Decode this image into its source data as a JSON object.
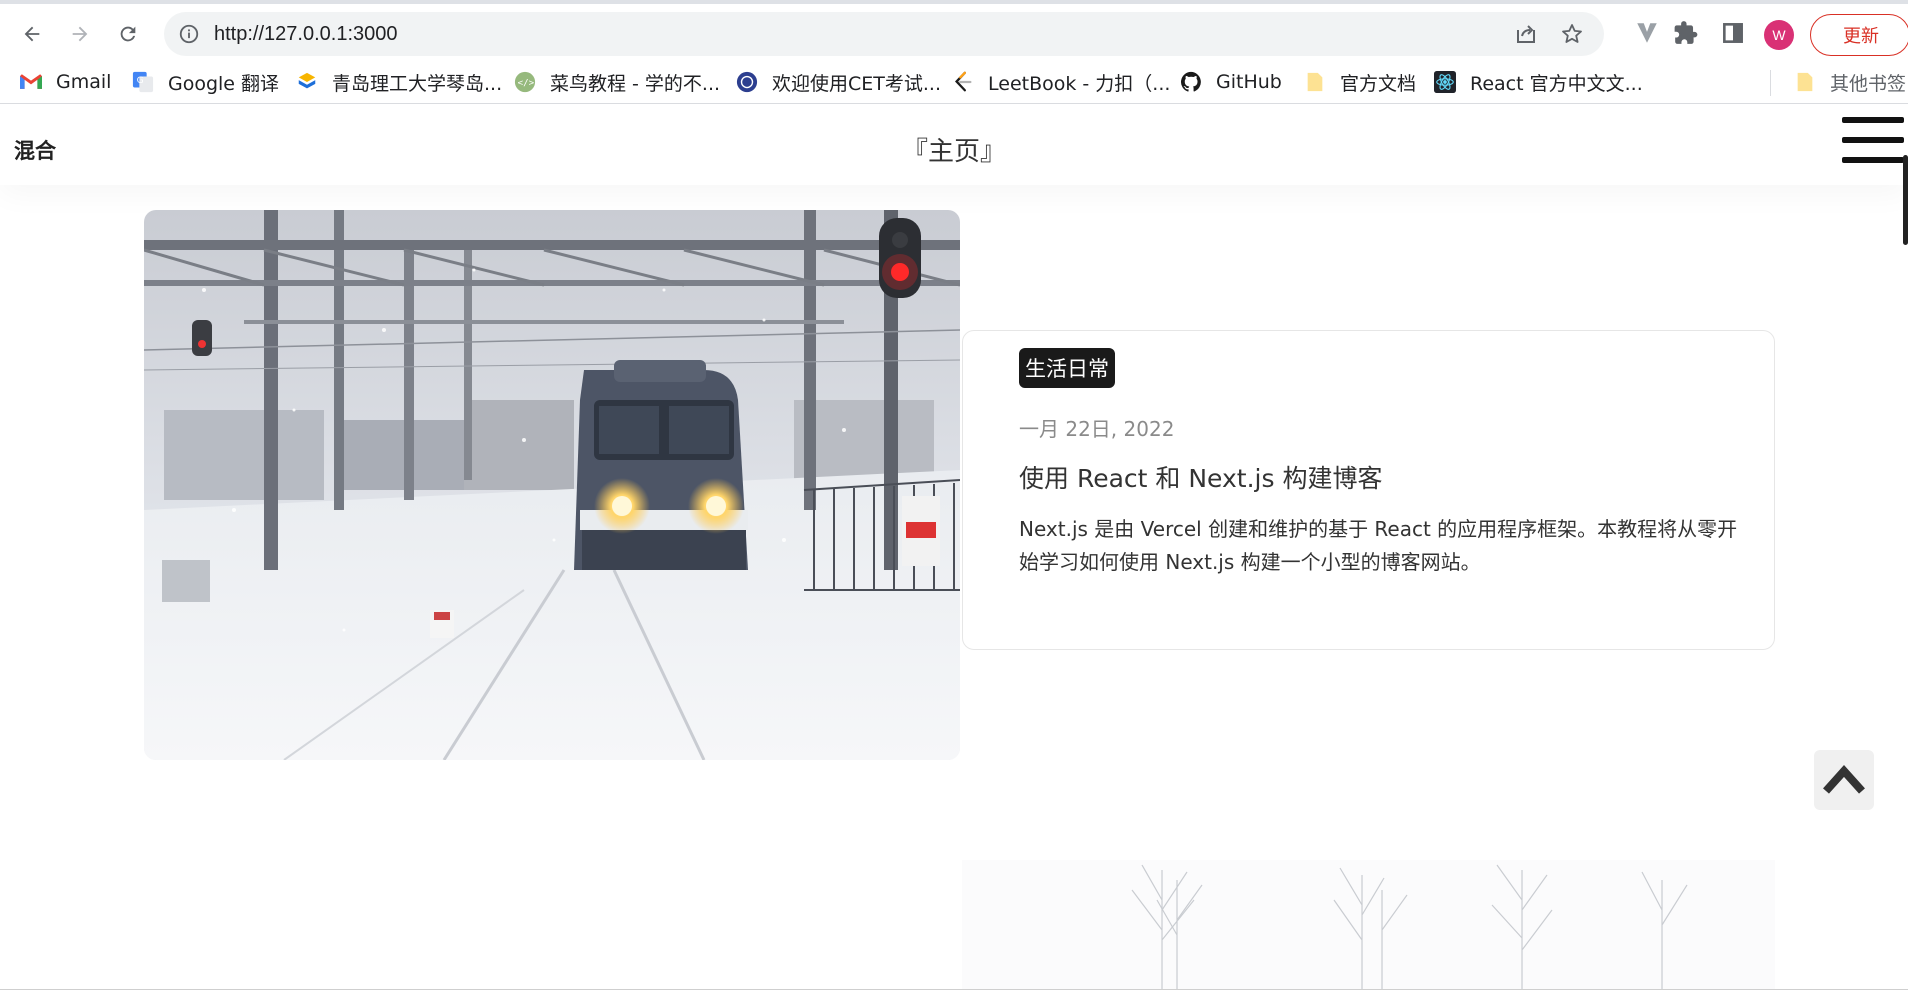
{
  "browser": {
    "url": "http://127.0.0.1:3000",
    "profile_initial": "W",
    "update_label": "更新",
    "accent": "#d93025",
    "icons": [
      "back-icon",
      "forward-icon",
      "reload-icon",
      "info-icon",
      "share-icon",
      "star-icon",
      "vivaldi-icon",
      "extensions-icon",
      "sidepanel-icon"
    ]
  },
  "bookmarks": [
    {
      "label": "Gmail",
      "icon": "gmail-icon"
    },
    {
      "label": "Google 翻译",
      "icon": "google-translate-icon"
    },
    {
      "label": "青岛理工大学琴岛...",
      "icon": "university-icon"
    },
    {
      "label": "菜鸟教程 - 学的不...",
      "icon": "runoob-icon"
    },
    {
      "label": "欢迎使用CET考试...",
      "icon": "cet-icon"
    },
    {
      "label": "LeetBook - 力扣（...",
      "icon": "leetcode-icon"
    },
    {
      "label": "GitHub",
      "icon": "github-icon"
    },
    {
      "label": "官方文档",
      "icon": "folder-icon"
    },
    {
      "label": "React 官方中文文...",
      "icon": "react-icon"
    }
  ],
  "other_bookmarks": {
    "label": "其他书签",
    "icon": "folder-icon"
  },
  "site": {
    "logo": "混合",
    "page_title": "『主页』"
  },
  "post": {
    "tag": "生活日常",
    "date": "一月 22日, 2022",
    "title": "使用 React 和 Next.js 构建博客",
    "excerpt": "Next.js 是由 Vercel 创建和维护的基于 React 的应用程序框架。本教程将从零开始学习如何使用 Next.js 构建一个小型的博客网站。"
  }
}
